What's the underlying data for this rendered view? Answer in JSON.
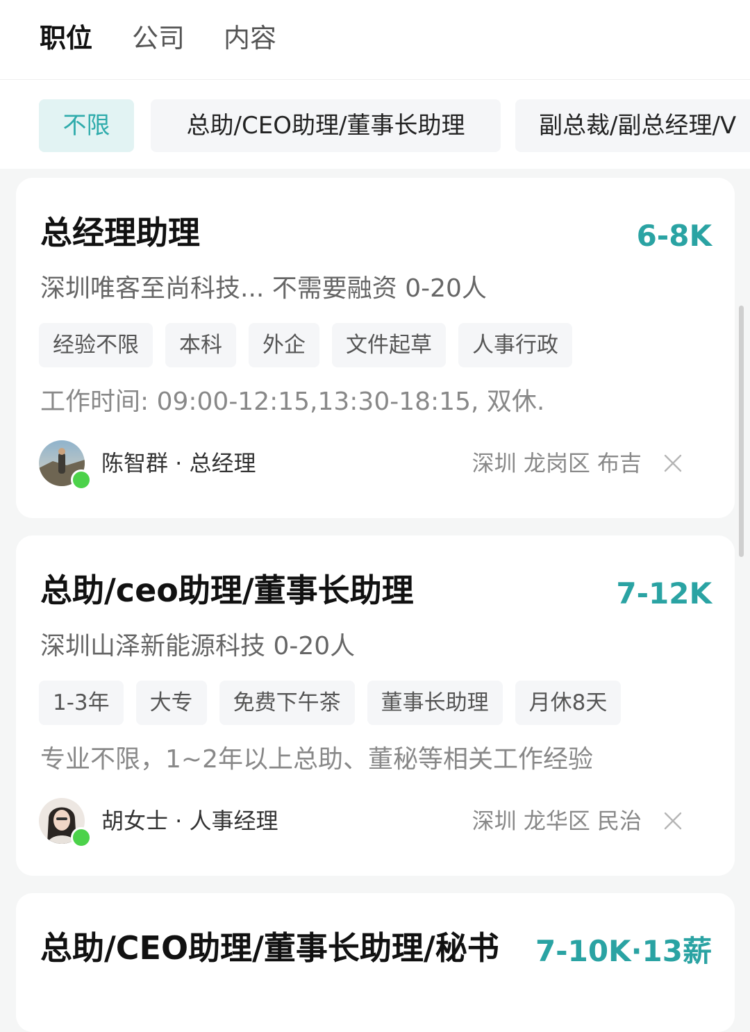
{
  "tabs": [
    {
      "label": "职位",
      "active": true
    },
    {
      "label": "公司",
      "active": false
    },
    {
      "label": "内容",
      "active": false
    }
  ],
  "filters": [
    {
      "label": "不限",
      "active": true
    },
    {
      "label": "总助/CEO助理/董事长助理",
      "active": false
    },
    {
      "label": "副总裁/副总经理/V",
      "active": false
    }
  ],
  "colors": {
    "accent": "#2aa3a3",
    "online": "#4cd24a",
    "chip_active_bg": "#e2f3f3"
  },
  "jobs": [
    {
      "title": "总经理助理",
      "salary": "6-8K",
      "company": "深圳唯客至尚科技... 不需要融资 0-20人",
      "tags": [
        "经验不限",
        "本科",
        "外企",
        "文件起草",
        "人事行政"
      ],
      "desc": "工作时间: 09:00-12:15,13:30-18:15, 双休.",
      "recruiter": "陈智群 · 总经理",
      "location": "深圳 龙岗区 布吉",
      "close_icon": "close-icon"
    },
    {
      "title": "总助/ceo助理/董事长助理",
      "salary": "7-12K",
      "company": "深圳山泽新能源科技 0-20人",
      "tags": [
        "1-3年",
        "大专",
        "免费下午茶",
        "董事长助理",
        "月休8天"
      ],
      "desc": "专业不限，1~2年以上总助、董秘等相关工作经验",
      "recruiter": "胡女士 · 人事经理",
      "location": "深圳 龙华区 民治",
      "close_icon": "close-icon"
    },
    {
      "title": "总助/CEO助理/董事长助理/秘书",
      "salary": "7-10K·13薪"
    }
  ]
}
